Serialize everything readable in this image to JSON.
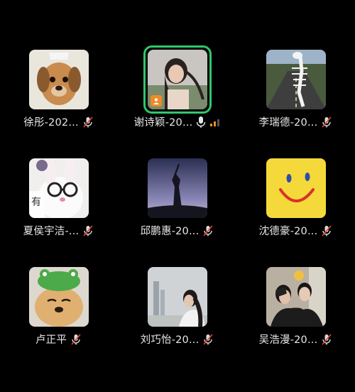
{
  "participants": [
    {
      "name": "徐彤-202...",
      "muted": true,
      "avatar": "puppy-photo"
    },
    {
      "name": "谢诗颖-20...",
      "muted": false,
      "speaking": true,
      "avatar": "woman-portrait-photo",
      "host": true
    },
    {
      "name": "李瑞德-20...",
      "muted": true,
      "avatar": "road-skeleton-photo"
    },
    {
      "name": "夏侯宇洁-...",
      "muted": true,
      "avatar": "plush-rabbit-glasses-photo"
    },
    {
      "name": "邱鹏惠-20...",
      "muted": true,
      "avatar": "statue-silhouette-photo"
    },
    {
      "name": "沈德豪-20...",
      "muted": true,
      "avatar": "smiley-face-image"
    },
    {
      "name": "卢正平",
      "muted": true,
      "avatar": "dog-frog-hat-photo"
    },
    {
      "name": "刘巧怡-20...",
      "muted": true,
      "avatar": "woman-city-photo"
    },
    {
      "name": "吴浩漫-20...",
      "muted": true,
      "avatar": "couple-selfie-photo"
    }
  ],
  "colors": {
    "active_border": "#2ec86a",
    "muted_icon": "#d9d9d9",
    "mute_slash": "#e0453a",
    "host_badge": "#f08a24"
  }
}
